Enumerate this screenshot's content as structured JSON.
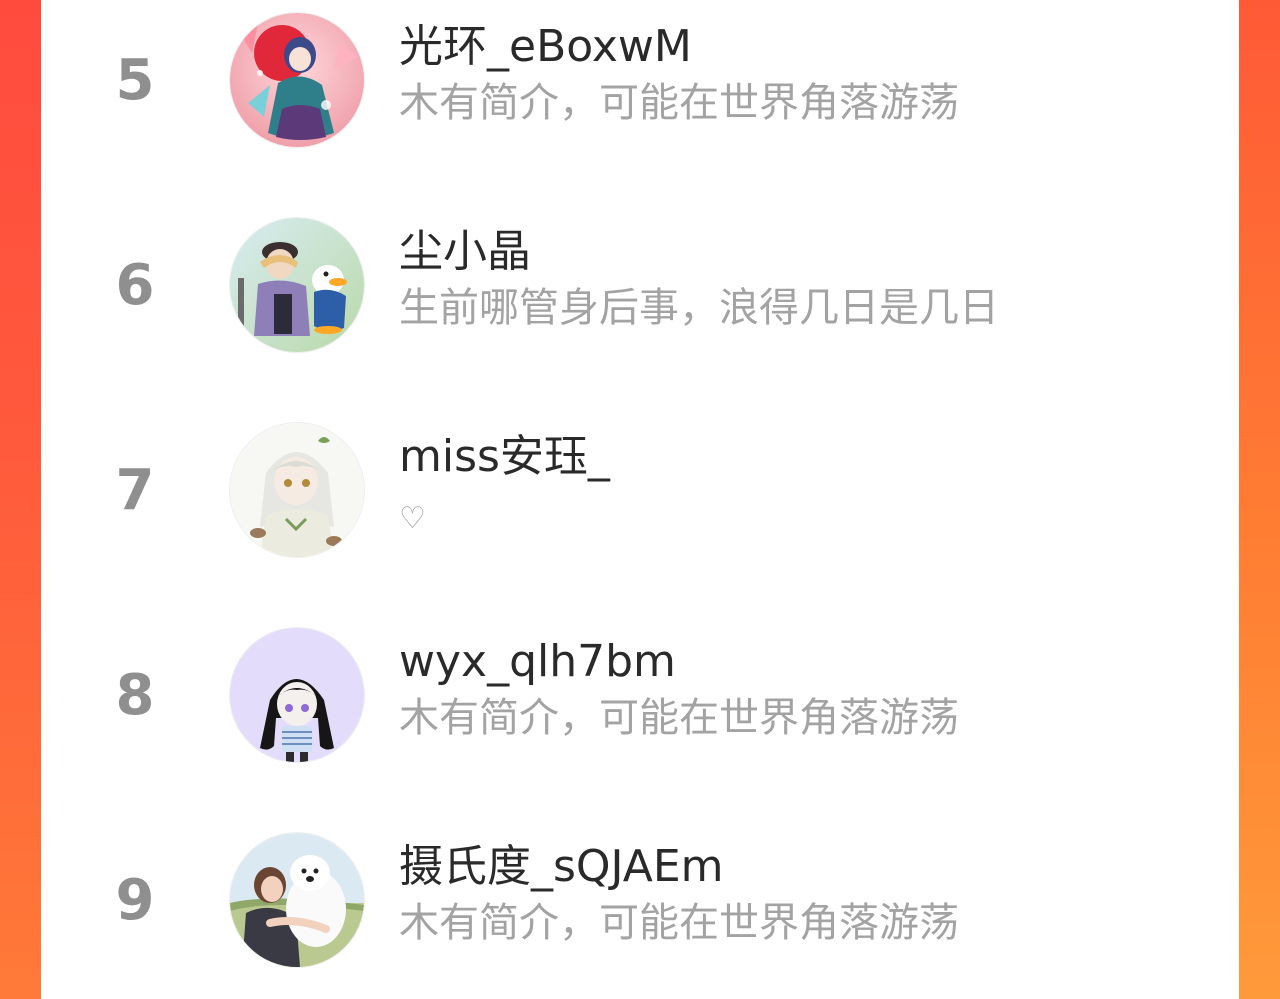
{
  "ranking": {
    "items": [
      {
        "rank": "5",
        "name": "光环_eBoxwM",
        "bio": "木有简介，可能在世界角落游荡",
        "avatar_icon": "anime-girl-avatar"
      },
      {
        "rank": "6",
        "name": "尘小晶",
        "bio": "生前哪管身后事，浪得几日是几日",
        "avatar_icon": "anime-boy-duck-avatar"
      },
      {
        "rank": "7",
        "name": "miss安珏_",
        "bio": "♡",
        "avatar_icon": "white-hair-girl-avatar"
      },
      {
        "rank": "8",
        "name": "wyx_qlh7bm",
        "bio": "木有简介，可能在世界角落游荡",
        "avatar_icon": "chibi-girl-avatar"
      },
      {
        "rank": "9",
        "name": "摄氏度_sQJAEm",
        "bio": "木有简介，可能在世界角落游荡",
        "avatar_icon": "girl-hugging-dog-avatar"
      }
    ]
  },
  "colors": {
    "accent_left": "#ff4b3e",
    "accent_right": "#ff7e33",
    "rank_text": "#8f8f8f",
    "name_text": "#2a2a2a",
    "bio_text": "#a3a3a3"
  }
}
